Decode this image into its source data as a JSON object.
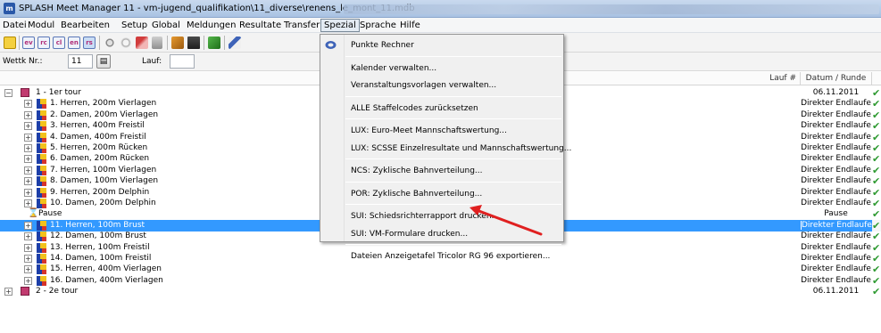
{
  "window": {
    "icon_letter": "m",
    "title": "SPLASH Meet Manager 11 - vm-jugend_qualifikation\\11_diverse\\renens_le_mont_11.mdb"
  },
  "menubar": {
    "items": [
      "Datei",
      "Modul",
      "Bearbeiten",
      "Setup",
      "Global",
      "Meldungen",
      "Resultate",
      "Transfer",
      "Spezial",
      "Sprache",
      "Hilfe"
    ],
    "open_item": "Spezial"
  },
  "toolbar": {
    "buttons": [
      "ev",
      "rc",
      "cl",
      "en",
      "rs"
    ]
  },
  "filter": {
    "wettk_label": "Wettk Nr.:",
    "wettk_value": "11",
    "lauf_label": "Lauf:",
    "lauf_value": ""
  },
  "columns": {
    "lauf": "Lauf #",
    "datum": "Datum / Runde"
  },
  "tree": [
    {
      "type": "tour",
      "label": "1 - 1er tour",
      "date": "06.11.2011",
      "expander": "−"
    },
    {
      "type": "event",
      "label": "1. Herren, 200m Vierlagen",
      "date": "Direkter Endlaufe"
    },
    {
      "type": "event",
      "label": "2. Damen, 200m Vierlagen",
      "date": "Direkter Endlaufe"
    },
    {
      "type": "event",
      "label": "3. Herren, 400m Freistil",
      "date": "Direkter Endlaufe"
    },
    {
      "type": "event",
      "label": "4. Damen, 400m Freistil",
      "date": "Direkter Endlaufe"
    },
    {
      "type": "event",
      "label": "5. Herren, 200m Rücken",
      "date": "Direkter Endlaufe"
    },
    {
      "type": "event",
      "label": "6. Damen, 200m Rücken",
      "date": "Direkter Endlaufe"
    },
    {
      "type": "event",
      "label": "7. Herren, 100m Vierlagen",
      "date": "Direkter Endlaufe"
    },
    {
      "type": "event",
      "label": "8. Damen, 100m Vierlagen",
      "date": "Direkter Endlaufe"
    },
    {
      "type": "event",
      "label": "9. Herren, 200m Delphin",
      "date": "Direkter Endlaufe"
    },
    {
      "type": "event",
      "label": "10. Damen, 200m Delphin",
      "date": "Direkter Endlaufe"
    },
    {
      "type": "pause",
      "label": "Pause",
      "date": "Pause"
    },
    {
      "type": "event",
      "label": "11. Herren, 100m Brust",
      "date": "Direkter Endlaufe",
      "selected": true
    },
    {
      "type": "event",
      "label": "12. Damen, 100m Brust",
      "date": "Direkter Endlaufe"
    },
    {
      "type": "event",
      "label": "13. Herren, 100m Freistil",
      "date": "Direkter Endlaufe"
    },
    {
      "type": "event",
      "label": "14. Damen, 100m Freistil",
      "date": "Direkter Endlaufe"
    },
    {
      "type": "event",
      "label": "15. Herren, 400m Vierlagen",
      "date": "Direkter Endlaufe"
    },
    {
      "type": "event",
      "label": "16. Damen, 400m Vierlagen",
      "date": "Direkter Endlaufe"
    },
    {
      "type": "tour",
      "label": "2 - 2e tour",
      "date": "06.11.2011",
      "expander": "+"
    }
  ],
  "dropdown": {
    "groups": [
      [
        "Punkte Rechner"
      ],
      [
        "Kalender verwalten...",
        "Veranstaltungsvorlagen verwalten..."
      ],
      [
        "ALLE Staffelcodes zurücksetzen"
      ],
      [
        "LUX: Euro-Meet Mannschaftswertung...",
        "LUX: SCSSE Einzelresultate und Mannschaftswertung..."
      ],
      [
        "NCS: Zyklische Bahnverteilung..."
      ],
      [
        "POR: Zyklische Bahnverteilung..."
      ],
      [
        "SUI: Schiedsrichterrapport drucken...",
        "SUI: VM-Formulare drucken..."
      ],
      [
        "Dateien Anzeigetafel Tricolor RG 96 exportieren..."
      ]
    ]
  },
  "colors": {
    "selection": "#3399ff",
    "check": "#2e9a31",
    "arrow": "#e02020"
  }
}
